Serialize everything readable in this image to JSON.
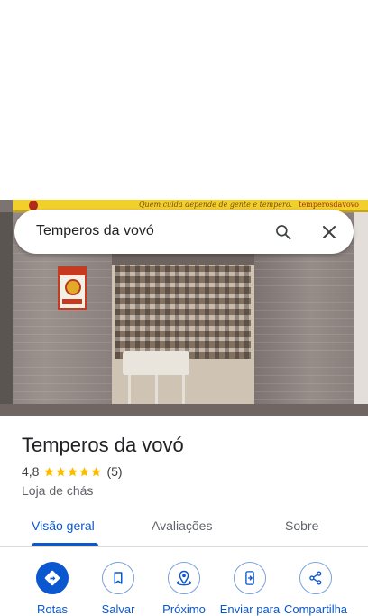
{
  "search": {
    "query": "Temperos da vovó"
  },
  "photo": {
    "sign_slogan": "Quem cuida depende de gente e tempero.",
    "sign_right": "temperosdavovo",
    "poster_label": "PEGUE TREM!"
  },
  "place": {
    "name": "Temperos da vovó",
    "rating": "4,8",
    "stars": 5,
    "review_count": "(5)",
    "category": "Loja de chás"
  },
  "tabs": [
    {
      "label": "Visão geral",
      "active": true
    },
    {
      "label": "Avaliações",
      "active": false
    },
    {
      "label": "Sobre",
      "active": false
    }
  ],
  "actions": [
    {
      "label": "Rotas",
      "icon": "directions-icon"
    },
    {
      "label": "Salvar",
      "icon": "bookmark-icon"
    },
    {
      "label": "Próximo",
      "icon": "nearby-icon"
    },
    {
      "label": "Enviar para",
      "icon": "send-to-phone-icon"
    },
    {
      "label": "Compartilha",
      "icon": "share-icon"
    }
  ],
  "colors": {
    "accent": "#0b57d0",
    "star": "#fbbc04",
    "text": "#202124",
    "muted": "#5f6368"
  }
}
